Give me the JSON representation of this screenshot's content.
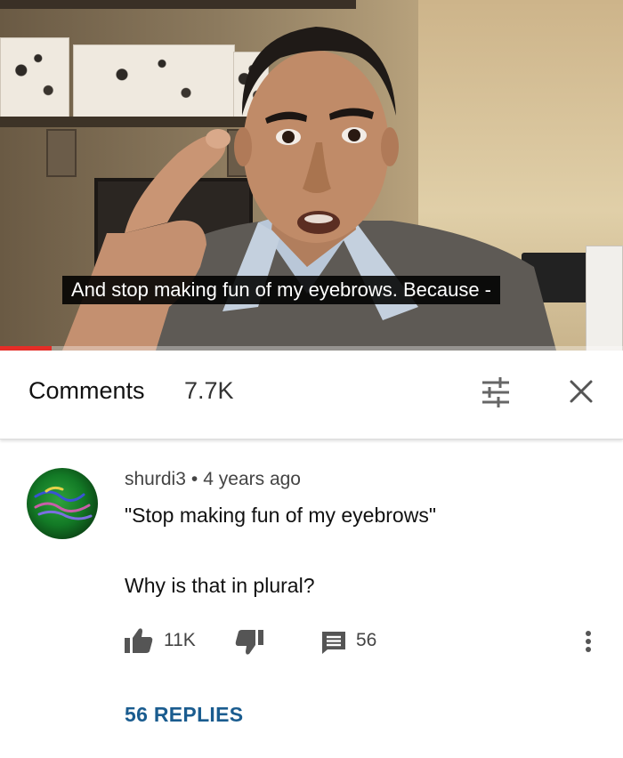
{
  "video": {
    "subtitle": "And stop making fun of my eyebrows. Because -",
    "progress_fraction": 0.083
  },
  "comments_panel": {
    "title": "Comments",
    "count": "7.7K",
    "sort_icon": "sort-filter-icon",
    "close_icon": "close-icon"
  },
  "comment": {
    "author": "shurdi3",
    "separator": "•",
    "time": "4 years ago",
    "text_line1": "\"Stop making fun of my eyebrows\"",
    "text_line2": "Why is that in plural?",
    "likes": "11K",
    "reply_count": "56",
    "replies_link": "56 REPLIES"
  },
  "colors": {
    "accent_link": "#1a5c8f",
    "progress": "#e52d27",
    "avatar": "#1d8a2c"
  }
}
